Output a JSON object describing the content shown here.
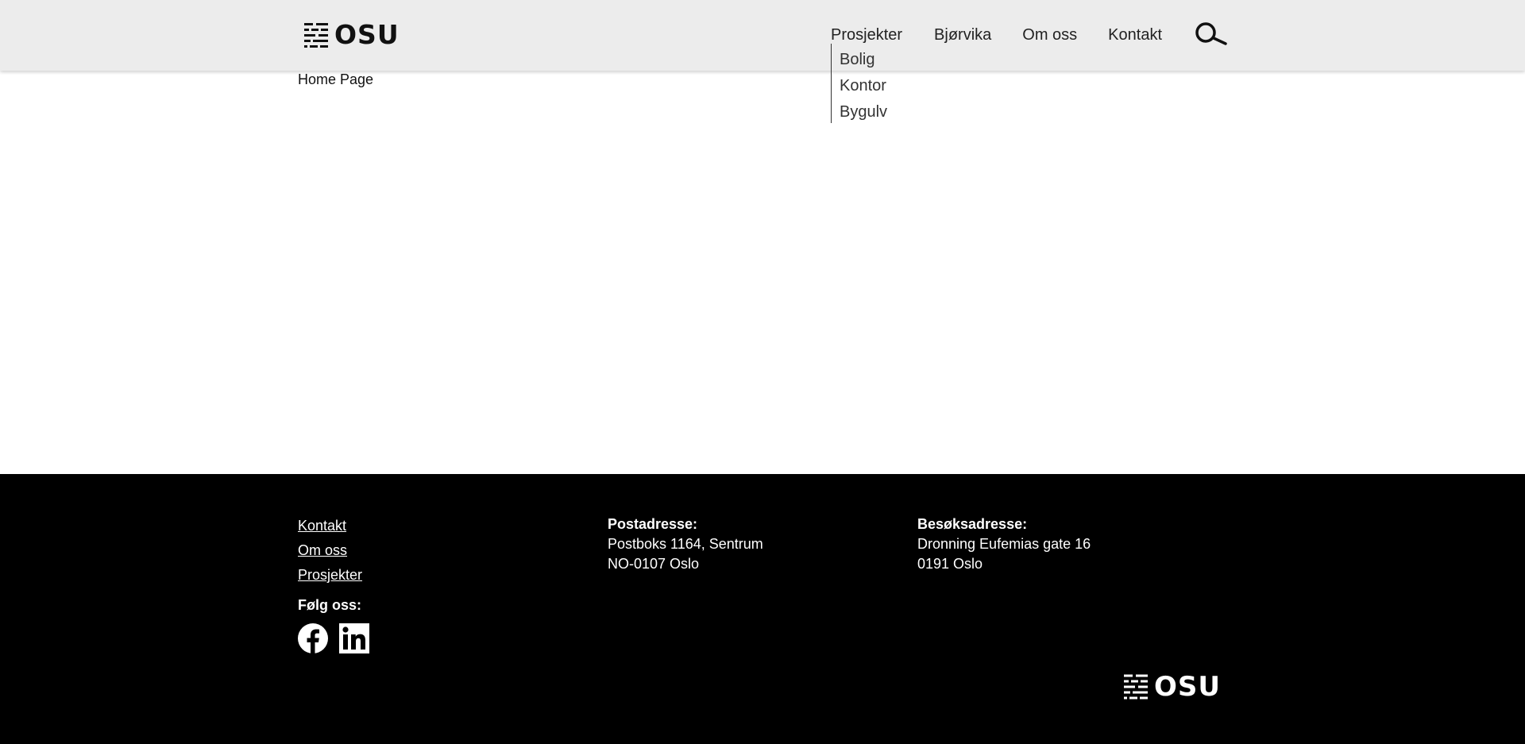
{
  "header": {
    "logo_text": "OSU",
    "nav": [
      "Prosjekter",
      "Bjørvika",
      "Om oss",
      "Kontakt"
    ],
    "dropdown": [
      "Bolig",
      "Kontor",
      "Bygulv"
    ],
    "search_icon": "search-icon"
  },
  "main": {
    "page_label": "Home Page"
  },
  "footer": {
    "links": [
      "Kontakt",
      "Om oss",
      "Prosjekter"
    ],
    "follow_label": "Følg oss:",
    "social": [
      "facebook-icon",
      "linkedin-icon"
    ],
    "postal": {
      "title": "Postadresse:",
      "line1": "Postboks 1164, Sentrum",
      "line2": "NO-0107 Oslo"
    },
    "visit": {
      "title": "Besøksadresse:",
      "line1": "Dronning Eufemias gate 16",
      "line2": "0191 Oslo"
    },
    "logo_text": "OSU"
  },
  "colors": {
    "header_bg": "#ececec",
    "footer_bg": "#000000",
    "text_dark": "#111111",
    "text_light": "#ffffff"
  }
}
